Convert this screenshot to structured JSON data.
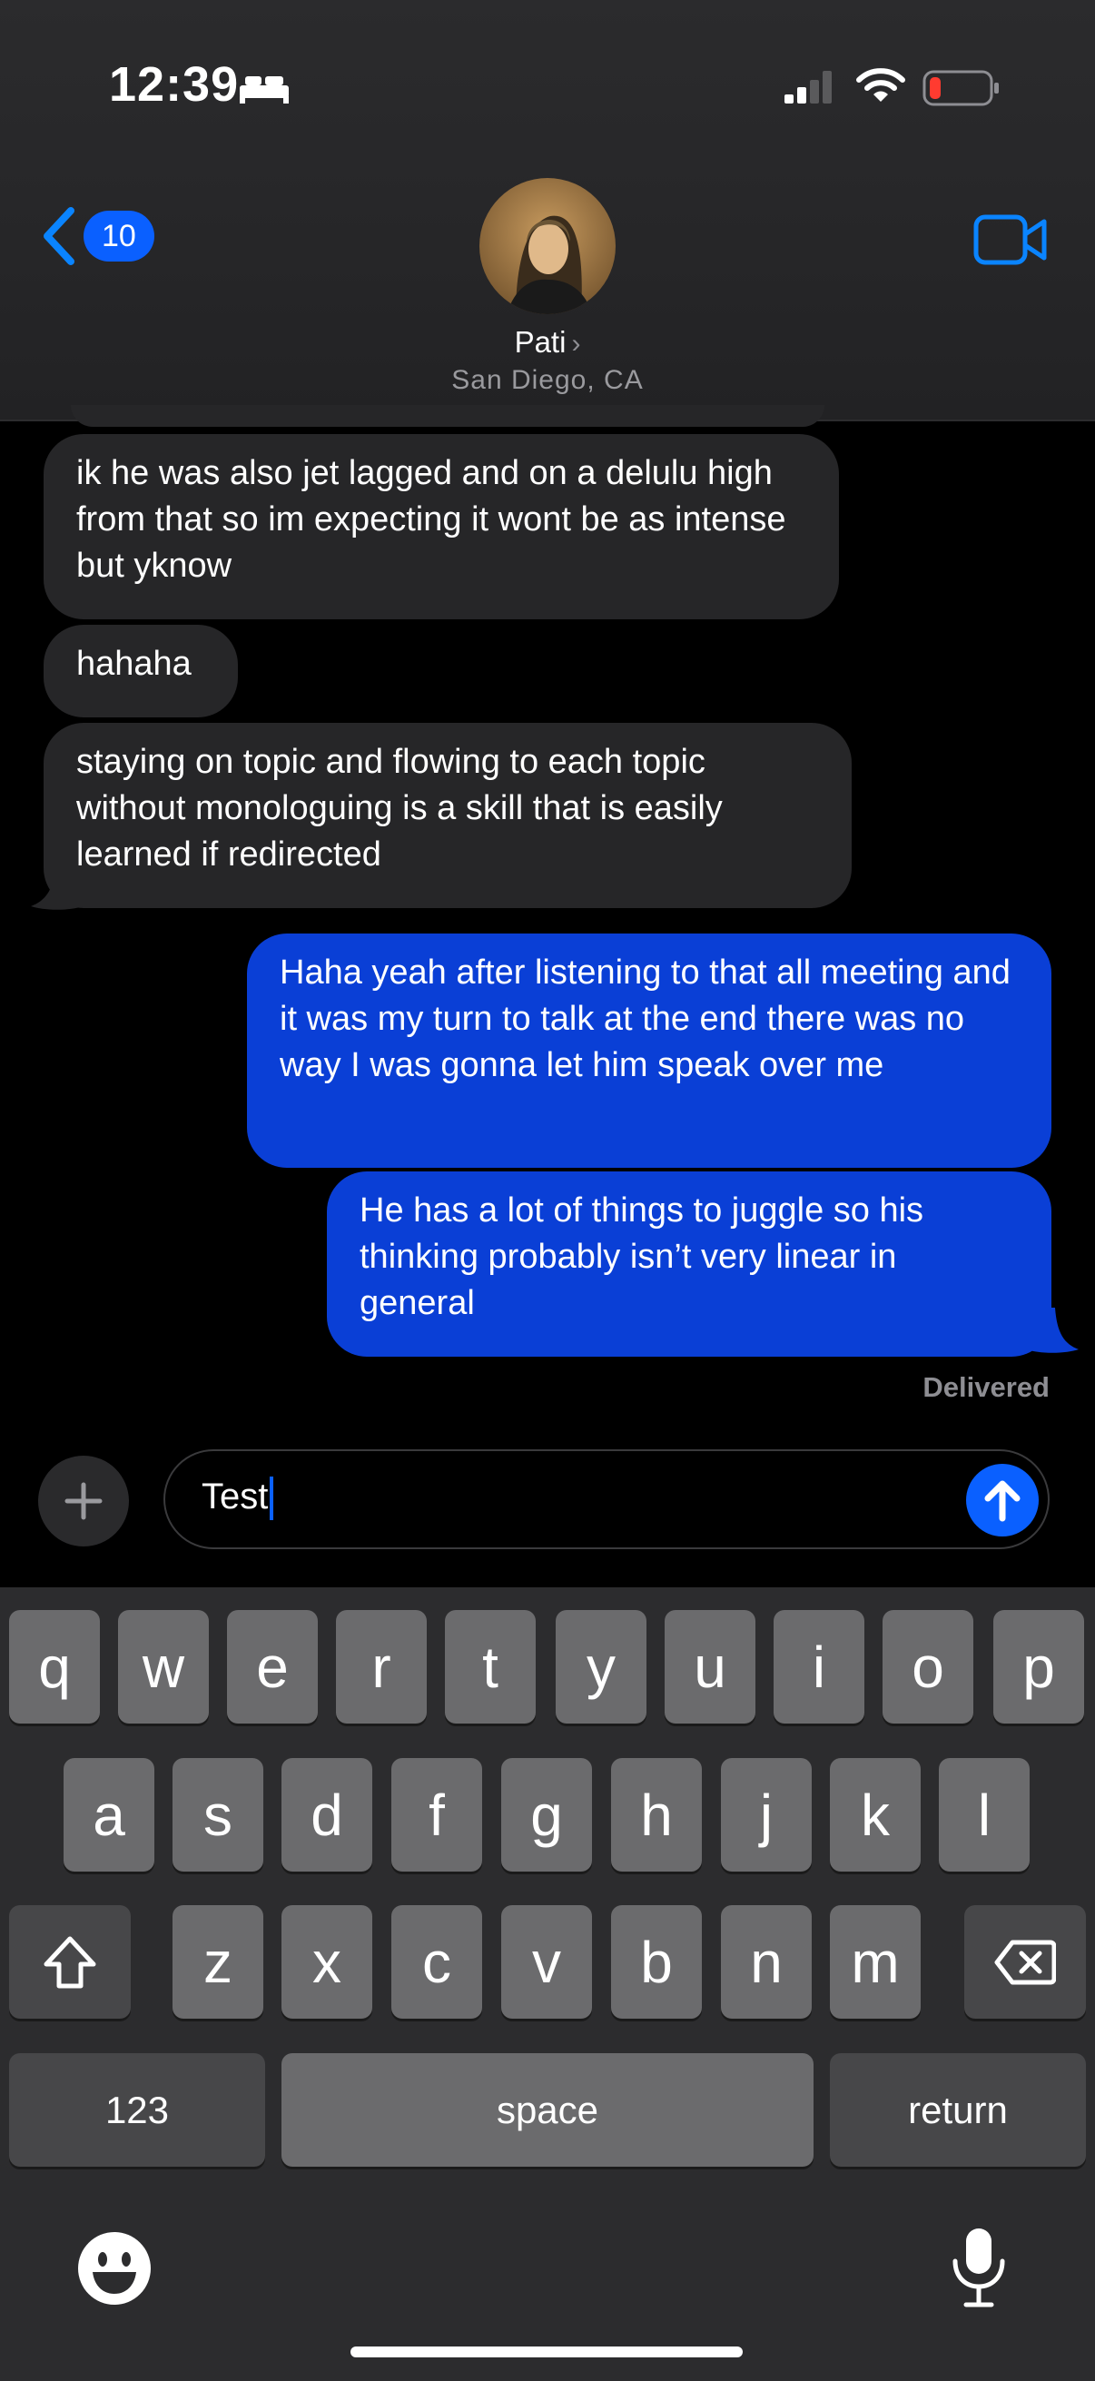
{
  "status_bar": {
    "time": "12:39"
  },
  "header": {
    "back_badge": "10",
    "contact_name": "Pati",
    "contact_location": "San Diego, CA"
  },
  "messages": [
    {
      "direction": "incoming",
      "text": "ik he was also jet lagged and on a delulu high from that so im expecting it wont be as intense but yknow"
    },
    {
      "direction": "incoming",
      "text": "hahaha"
    },
    {
      "direction": "incoming",
      "text": "staying on topic and flowing to each topic without monologuing is a skill that is easily learned if redirected"
    },
    {
      "direction": "outgoing",
      "text": "Haha yeah after listening to that all meeting and it was my turn to talk at the end there was no way I was gonna let him speak over me"
    },
    {
      "direction": "outgoing",
      "text": "He has a lot of things to juggle so his thinking probably isn’t very linear in general"
    }
  ],
  "delivery_status": "Delivered",
  "composer": {
    "text": "Test"
  },
  "keyboard": {
    "row1": [
      "q",
      "w",
      "e",
      "r",
      "t",
      "y",
      "u",
      "i",
      "o",
      "p"
    ],
    "row2": [
      "a",
      "s",
      "d",
      "f",
      "g",
      "h",
      "j",
      "k",
      "l"
    ],
    "row3": [
      "z",
      "x",
      "c",
      "v",
      "b",
      "n",
      "m"
    ],
    "numbers_label": "123",
    "space_label": "space",
    "return_label": "return"
  },
  "colors": {
    "accent": "#0a60ff",
    "outgoing_bubble": "#0a3fd6",
    "incoming_bubble": "#262628",
    "battery_low": "#ff3b30"
  },
  "icons": [
    "bed-icon",
    "signal-icon",
    "wifi-icon",
    "battery-icon",
    "back-chevron-icon",
    "video-camera-icon",
    "plus-icon",
    "send-arrow-icon",
    "shift-icon",
    "delete-icon",
    "emoji-icon",
    "microphone-icon"
  ]
}
